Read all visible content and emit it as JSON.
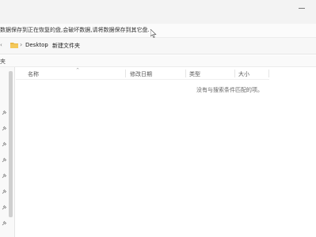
{
  "warning": {
    "message": "数据保存到正在恢复的盘,会破坏数据,请将数据保存到其它盘."
  },
  "address_bar": {
    "path": [
      "Desktop",
      "新建文件夹"
    ]
  },
  "toolbar": {
    "label": "夹"
  },
  "columns": {
    "name": "名称",
    "modified": "修改日期",
    "type": "类型",
    "size": "大小"
  },
  "content": {
    "empty_message": "没有与搜索条件匹配的项。"
  },
  "icons": {
    "folder": "folder-icon",
    "pin": "pin-icon",
    "cursor": "mouse-cursor-icon"
  },
  "colors": {
    "folder": "#e9b949",
    "scrollbar": "#cfcfcf"
  }
}
